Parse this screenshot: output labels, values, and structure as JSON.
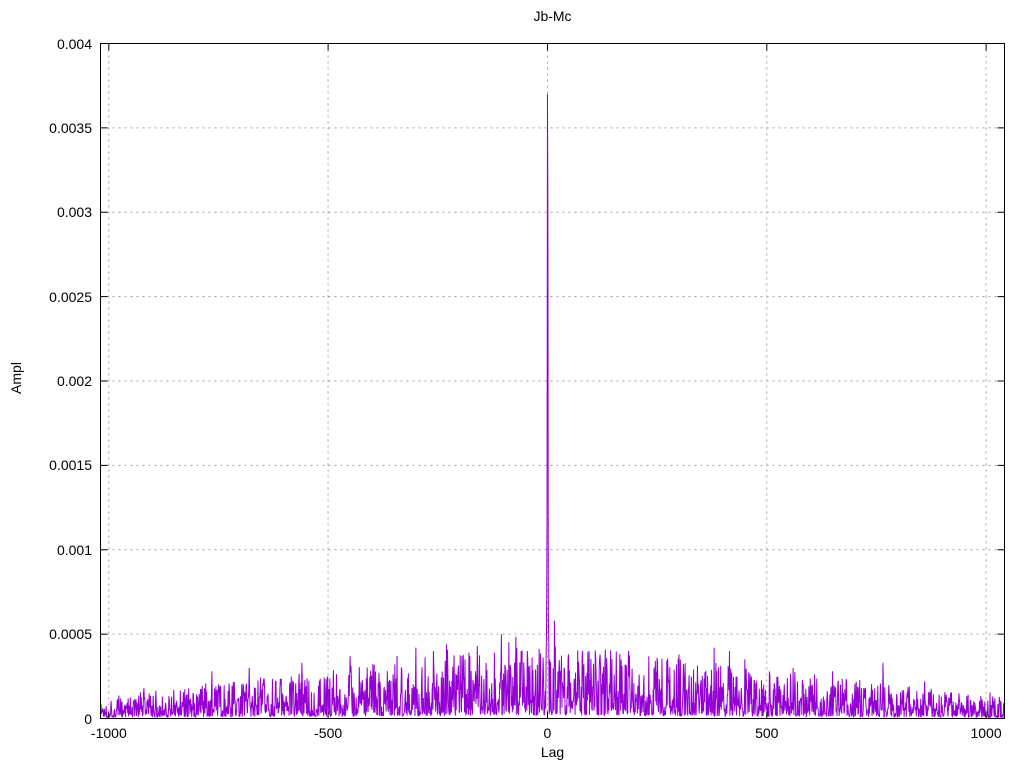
{
  "window": {
    "background": "#ffffff",
    "text_color": "#000000"
  },
  "chart_data": {
    "type": "line",
    "title": "Jb-Mc",
    "xlabel": "Lag",
    "ylabel": "Ampl",
    "xlim": [
      -1019,
      1042
    ],
    "ylim": [
      0,
      0.004
    ],
    "grid": true,
    "legend": "none",
    "series_color": "#9400d3",
    "grid_color": "#9e9e9e",
    "axis_color": "#000000",
    "xticks": [
      {
        "value": -1000,
        "label": "-1000"
      },
      {
        "value": -500,
        "label": "-500"
      },
      {
        "value": 0,
        "label": "0"
      },
      {
        "value": 500,
        "label": "500"
      },
      {
        "value": 1000,
        "label": "1000"
      }
    ],
    "yticks": [
      {
        "value": 0.0,
        "label": "0"
      },
      {
        "value": 0.0005,
        "label": "0.0005"
      },
      {
        "value": 0.001,
        "label": "0.001"
      },
      {
        "value": 0.0015,
        "label": "0.0015"
      },
      {
        "value": 0.002,
        "label": "0.002"
      },
      {
        "value": 0.0025,
        "label": "0.0025"
      },
      {
        "value": 0.003,
        "label": "0.003"
      },
      {
        "value": 0.0035,
        "label": "0.0035"
      },
      {
        "value": 0.004,
        "label": "0.004"
      }
    ],
    "main_peak": {
      "lag": 0,
      "value": 0.0037
    },
    "center_cluster": [
      [
        -3,
        0.00038
      ],
      [
        -2,
        0.00055
      ],
      [
        -1,
        0.00118
      ],
      [
        0,
        0.0037
      ],
      [
        1,
        0.00303
      ],
      [
        2,
        0.00062
      ],
      [
        3,
        0.00045
      ]
    ],
    "notable_spikes": [
      [
        -920,
        0.00018
      ],
      [
        -765,
        0.00028
      ],
      [
        -680,
        0.0003
      ],
      [
        -560,
        0.00033
      ],
      [
        -450,
        0.00037
      ],
      [
        -343,
        0.00037
      ],
      [
        -300,
        0.00042
      ],
      [
        -260,
        0.0004
      ],
      [
        -230,
        0.00044
      ],
      [
        -160,
        0.00043
      ],
      [
        -105,
        0.0005
      ],
      [
        -60,
        0.0004
      ],
      [
        16,
        0.00058
      ],
      [
        80,
        0.0004
      ],
      [
        120,
        0.00038
      ],
      [
        185,
        0.0004
      ],
      [
        250,
        0.00036
      ],
      [
        300,
        0.00038
      ],
      [
        380,
        0.00042
      ],
      [
        415,
        0.0004
      ],
      [
        450,
        0.00035
      ],
      [
        560,
        0.0003
      ],
      [
        650,
        0.00028
      ],
      [
        765,
        0.00033
      ],
      [
        860,
        0.00022
      ]
    ],
    "noise": {
      "seed": 1337,
      "step": 1,
      "envelope_edge": 7.5e-05,
      "envelope_center": 0.00028,
      "envelope_half_width": 1050,
      "description": "triangular noise envelope, dense random amplitude trace sitting on zero baseline"
    }
  }
}
